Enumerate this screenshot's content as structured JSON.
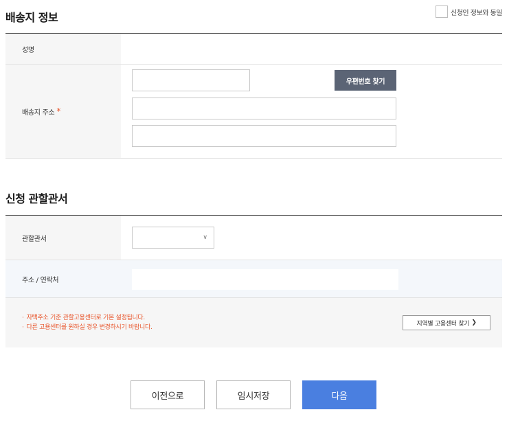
{
  "delivery": {
    "title": "배송지 정보",
    "same_as_applicant": "신청인 정보와 동일",
    "name_label": "성명",
    "address_label": "배송지 주소",
    "required_mark": "*",
    "zip_button": "우편번호 찾기"
  },
  "office": {
    "title": "신청 관할관서",
    "office_label": "관할관서",
    "contact_label": "주소 / 연락처",
    "notices": [
      "자택주소 기준 관할고용센터로 기본 설정됩니다.",
      "다른 고용센터를 원하실 경우 변경하시기 바랍니다."
    ],
    "region_button": "지역별 고용센터 찾기",
    "region_button_arrow": "❯"
  },
  "actions": {
    "prev": "이전으로",
    "save": "임시저장",
    "next": "다음"
  },
  "colors": {
    "accent": "#4a7fe0",
    "notice": "#e8542a",
    "zip_button": "#5b6475"
  }
}
